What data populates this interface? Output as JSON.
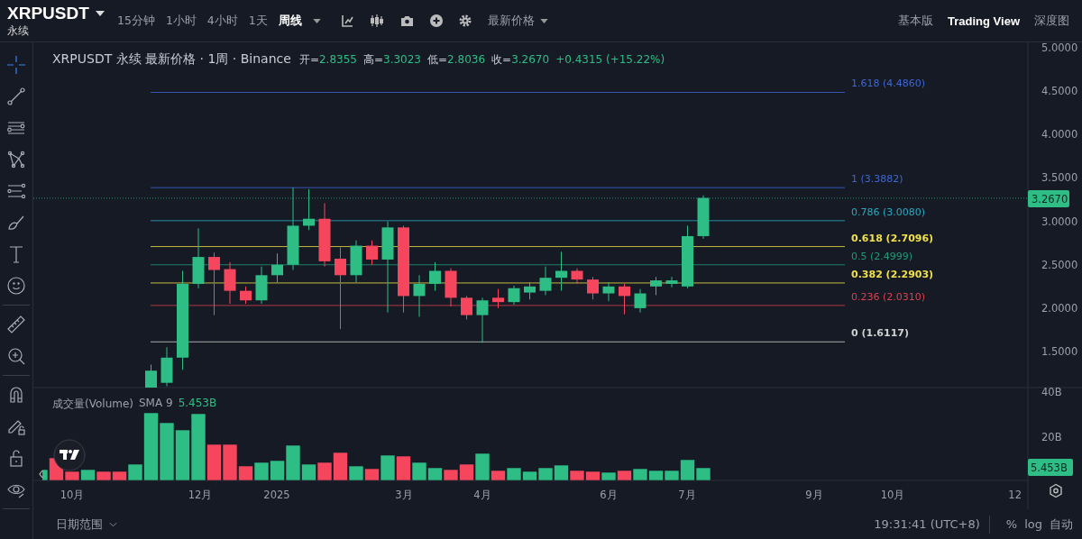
{
  "symbol": {
    "name": "XRPUSDT",
    "contract": "永续"
  },
  "intervals": [
    {
      "label": "15分钟",
      "selected": false
    },
    {
      "label": "1小时",
      "selected": false
    },
    {
      "label": "4小时",
      "selected": false
    },
    {
      "label": "1天",
      "selected": false
    },
    {
      "label": "周线",
      "selected": true
    }
  ],
  "price_source": "最新价格",
  "view_tabs": [
    {
      "label": "基本版",
      "selected": false
    },
    {
      "label": "Trading View",
      "selected": true
    },
    {
      "label": "深度图",
      "selected": false
    }
  ],
  "tools": [
    {
      "selected": true
    },
    {
      "selected": false
    },
    {
      "selected": false
    },
    {
      "selected": false
    },
    {
      "selected": false
    },
    {
      "selected": false
    },
    {
      "selected": false
    },
    {
      "selected": false
    },
    {
      "selected": false
    },
    {
      "selected": false
    },
    {
      "selected": false
    },
    {
      "selected": false
    },
    {
      "selected": false
    },
    {
      "selected": false
    }
  ],
  "legend": {
    "title": "XRPUSDT 永续 最新价格 · 1周 · Binance",
    "ohlc": [
      {
        "label": "开=",
        "value": "2.8355"
      },
      {
        "label": "高=",
        "value": "3.3023"
      },
      {
        "label": "低=",
        "value": "2.8036"
      },
      {
        "label": "收=",
        "value": "3.2670"
      }
    ],
    "change": "+0.4315 (+15.22%)"
  },
  "fib_levels": [
    {
      "label": "1.618 (4.4860)",
      "color": "#3d67d6"
    },
    {
      "label": "1 (3.3882)",
      "color": "#3d67d6"
    },
    {
      "label": "0.786 (3.0080)",
      "color": "#2aa9c2"
    },
    {
      "label": "0.618 (2.7096)",
      "color": "#f0e04a"
    },
    {
      "label": "0.5 (2.4999)",
      "color": "#1f9a78"
    },
    {
      "label": "0.382 (2.2903)",
      "color": "#f0e04a"
    },
    {
      "label": "0.236 (2.0310)",
      "color": "#d9424e"
    },
    {
      "label": "0 (1.6117)",
      "color": "#d0d0d0"
    }
  ],
  "price_axis": [
    "5.0000",
    "4.5000",
    "4.0000",
    "3.5000",
    "3.0000",
    "2.5000",
    "2.0000",
    "1.5000"
  ],
  "current_price": "3.2670",
  "volume": {
    "title": "成交量(Volume)",
    "sma": "SMA 9",
    "value": "5.453B",
    "axis": [
      "40B",
      "20B"
    ],
    "tag": "5.453B"
  },
  "time_axis": [
    "10月",
    "12月",
    "2025",
    "3月",
    "4月",
    "6月",
    "7月",
    "9月",
    "10月",
    "12"
  ],
  "bottom_bar": {
    "date_range": "日期范围",
    "clock": "19:31:41 (UTC+8)",
    "buttons": [
      "%",
      "log",
      "自动"
    ]
  }
}
